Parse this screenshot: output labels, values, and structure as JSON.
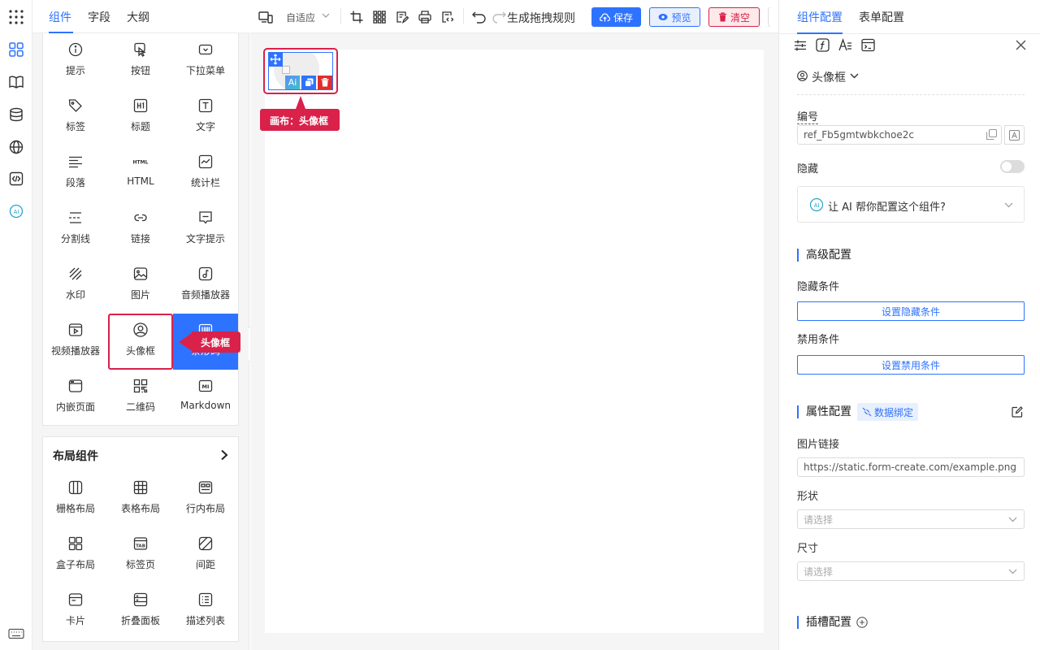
{
  "left_tabs": [
    "组件",
    "字段",
    "大纲"
  ],
  "components": [
    {
      "label": "提示",
      "icon": "info-circle-icon"
    },
    {
      "label": "按钮",
      "icon": "button-icon"
    },
    {
      "label": "下拉菜单",
      "icon": "dropdown-icon"
    },
    {
      "label": "标签",
      "icon": "tag-icon"
    },
    {
      "label": "标题",
      "icon": "heading-icon"
    },
    {
      "label": "文字",
      "icon": "text-icon"
    },
    {
      "label": "段落",
      "icon": "paragraph-icon"
    },
    {
      "label": "HTML",
      "icon": "html-icon"
    },
    {
      "label": "统计栏",
      "icon": "statistic-icon"
    },
    {
      "label": "分割线",
      "icon": "divider-icon"
    },
    {
      "label": "链接",
      "icon": "link-icon"
    },
    {
      "label": "文字提示",
      "icon": "tooltip-icon"
    },
    {
      "label": "水印",
      "icon": "watermark-icon"
    },
    {
      "label": "图片",
      "icon": "image-icon"
    },
    {
      "label": "音频播放器",
      "icon": "audio-icon"
    },
    {
      "label": "视频播放器",
      "icon": "video-icon"
    },
    {
      "label": "头像框",
      "icon": "avatar-icon"
    },
    {
      "label": "条形码",
      "icon": "barcode-icon"
    },
    {
      "label": "内嵌页面",
      "icon": "iframe-icon"
    },
    {
      "label": "二维码",
      "icon": "qrcode-icon"
    },
    {
      "label": "Markdown",
      "icon": "markdown-icon"
    }
  ],
  "layout_section": {
    "title": "布局组件",
    "items": [
      {
        "label": "栅格布局",
        "icon": "grid-icon"
      },
      {
        "label": "表格布局",
        "icon": "table-layout-icon"
      },
      {
        "label": "行内布局",
        "icon": "inline-layout-icon"
      },
      {
        "label": "盒子布局",
        "icon": "box-layout-icon"
      },
      {
        "label": "标签页",
        "icon": "tabs-icon"
      },
      {
        "label": "间距",
        "icon": "space-icon"
      },
      {
        "label": "卡片",
        "icon": "card-icon"
      },
      {
        "label": "折叠面板",
        "icon": "collapse-icon"
      },
      {
        "label": "描述列表",
        "icon": "descriptions-icon"
      }
    ]
  },
  "drag_tooltip": "头像框",
  "toolbar": {
    "device_select": "自适应",
    "generate_rules": "生成拖拽规则",
    "save": "保存",
    "preview": "预览",
    "clear": "清空"
  },
  "canvas": {
    "tooltip": "画布：头像框"
  },
  "right_tabs": [
    "组件配置",
    "表单配置"
  ],
  "right": {
    "component_type": "头像框",
    "id_label": "编号",
    "id_value": "ref_Fb5gmtwbkchoe2c",
    "hidden_label": "隐藏",
    "hidden_on": false,
    "ai_prompt": "让 AI 帮你配置这个组件?",
    "advanced_title": "高级配置",
    "hide_cond_label": "隐藏条件",
    "hide_cond_btn": "设置隐藏条件",
    "disable_cond_label": "禁用条件",
    "disable_cond_btn": "设置禁用条件",
    "props_title": "属性配置",
    "data_binding": "数据绑定",
    "img_link_label": "图片链接",
    "img_link_value": "https://static.form-create.com/example.png",
    "shape_label": "形状",
    "shape_placeholder": "请选择",
    "size_label": "尺寸",
    "size_placeholder": "请选择",
    "slot_title": "插槽配置"
  },
  "colors": {
    "primary": "#2e73ff",
    "danger": "#d9214a",
    "clear_bg": "#fde8ea"
  }
}
